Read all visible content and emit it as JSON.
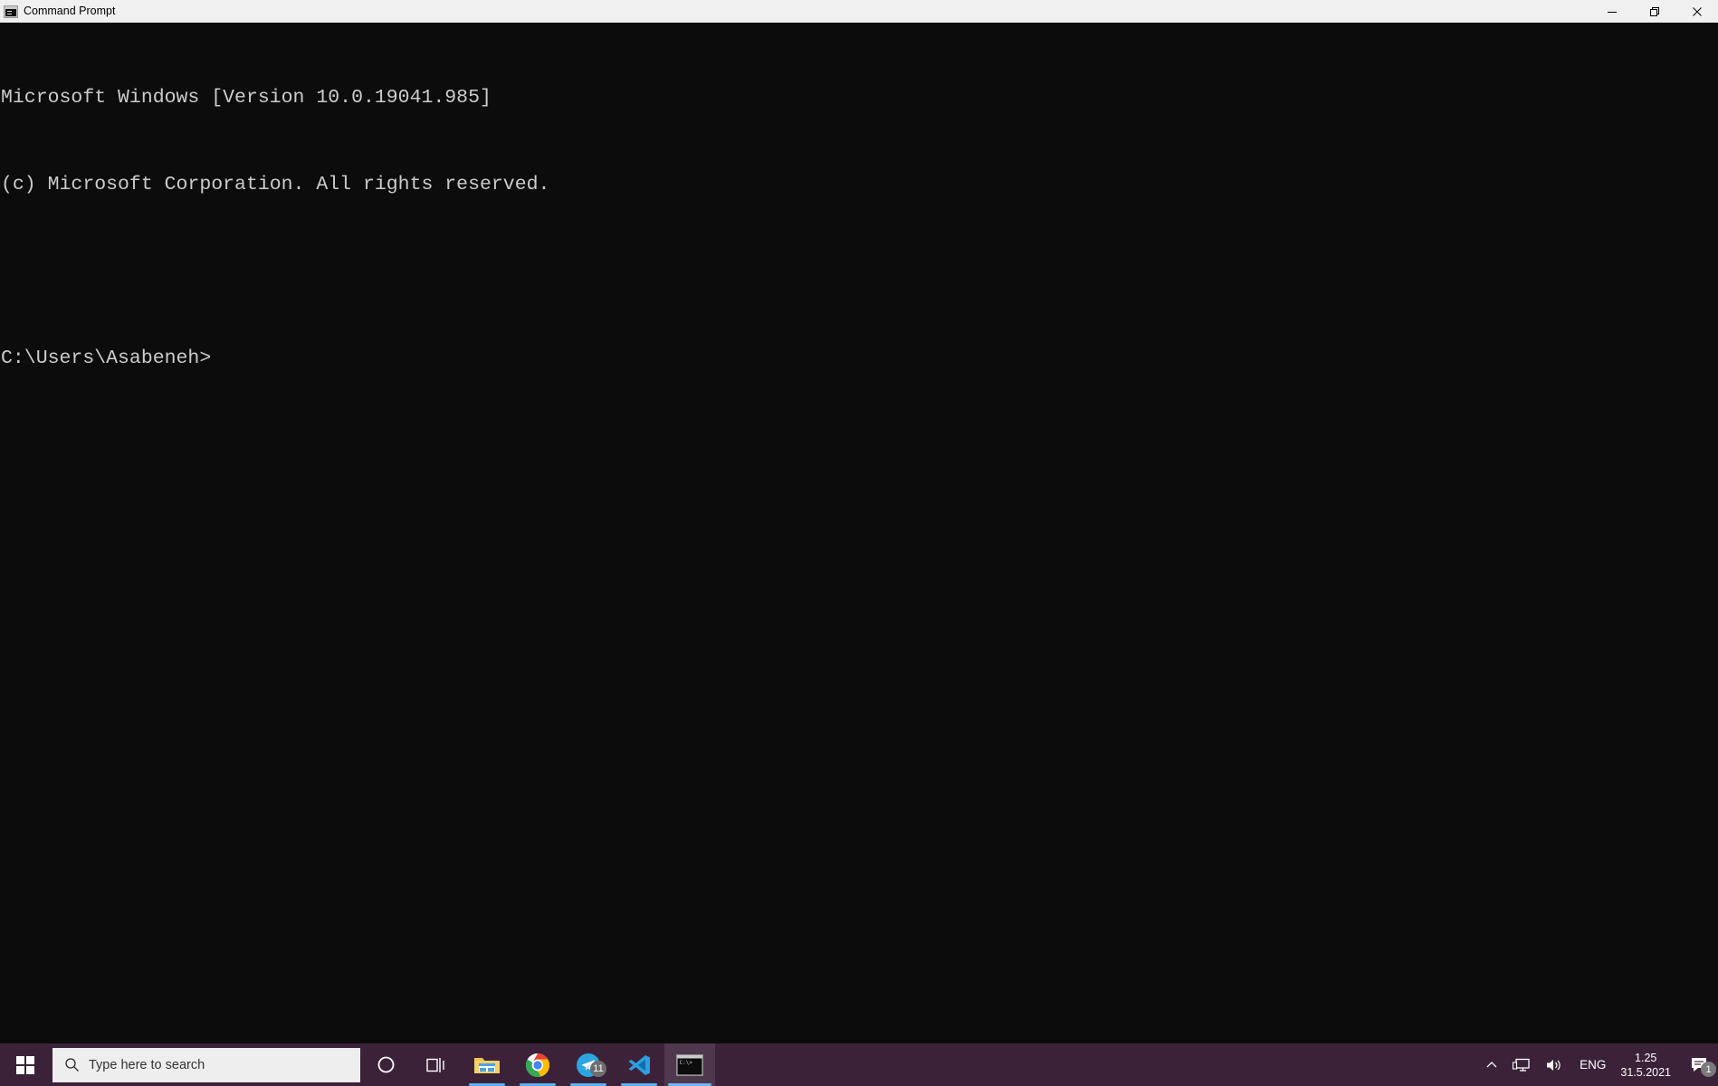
{
  "window": {
    "title": "Command Prompt",
    "icon": "console-window-icon",
    "controls": {
      "minimize": "Minimize",
      "maximize": "Restore Down",
      "close": "Close"
    },
    "background_color": "#0c0c0c",
    "text_color": "#cccccc",
    "titlebar_color": "#f0f0f0"
  },
  "console": {
    "lines": [
      "Microsoft Windows [Version 10.0.19041.985]",
      "(c) Microsoft Corporation. All rights reserved.",
      "",
      "C:\\Users\\Asabeneh>"
    ]
  },
  "taskbar": {
    "background_color": "#3b2239",
    "start": {
      "label": "Start",
      "icon": "windows-logo-icon"
    },
    "search": {
      "placeholder": "Type here to search",
      "icon": "search-icon",
      "value": ""
    },
    "cortana": {
      "label": "Cortana",
      "icon": "cortana-circle-icon"
    },
    "task_view": {
      "label": "Task View",
      "icon": "task-view-icon"
    },
    "apps": [
      {
        "name": "File Explorer",
        "icon": "file-explorer-icon",
        "running": true,
        "active": false,
        "badge": ""
      },
      {
        "name": "Google Chrome",
        "icon": "chrome-icon",
        "running": true,
        "active": false,
        "badge": ""
      },
      {
        "name": "Telegram",
        "icon": "telegram-icon",
        "running": true,
        "active": false,
        "badge": "11"
      },
      {
        "name": "Visual Studio Code",
        "icon": "vscode-icon",
        "running": true,
        "active": false,
        "badge": ""
      },
      {
        "name": "Command Prompt",
        "icon": "command-prompt-icon",
        "running": true,
        "active": true,
        "badge": ""
      }
    ],
    "tray": {
      "show_hidden": {
        "label": "Show hidden icons",
        "icon": "chevron-up-icon"
      },
      "network": {
        "label": "Network",
        "icon": "network-monitor-icon"
      },
      "volume": {
        "label": "Volume",
        "icon": "speaker-icon"
      },
      "language": "ENG",
      "clock": {
        "time": "1.25",
        "date": "31.5.2021"
      },
      "notifications": {
        "icon": "notification-icon",
        "count": "1"
      }
    },
    "accent_indicator_color": "#5ab0f2"
  }
}
